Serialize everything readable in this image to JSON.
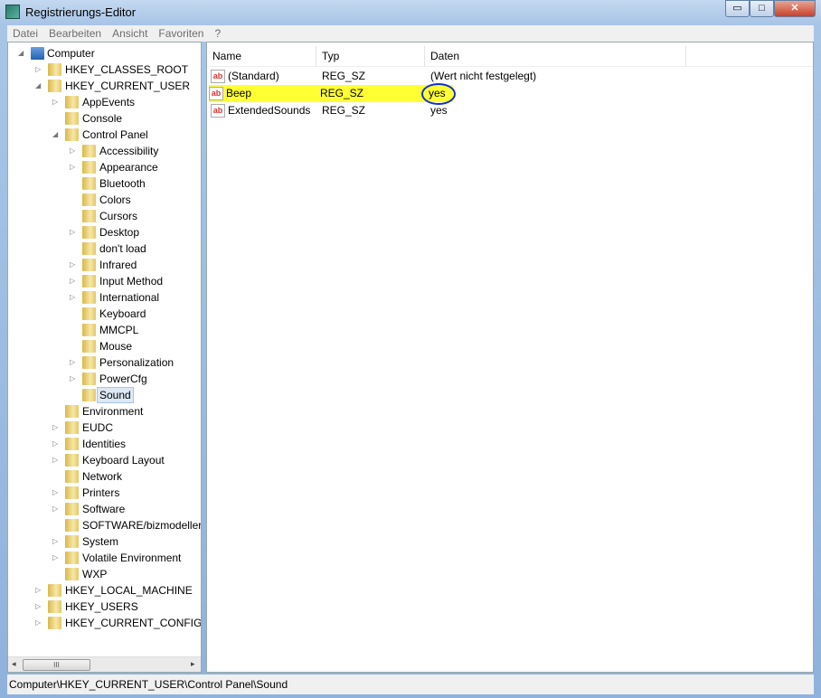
{
  "window": {
    "title": "Registrierungs-Editor",
    "minimize": "▭",
    "maximize": "□",
    "close": "✕"
  },
  "menu": [
    "Datei",
    "Bearbeiten",
    "Ansicht",
    "Favoriten",
    "?"
  ],
  "tree": [
    {
      "label": "Computer",
      "level": 0,
      "expander": "expanded"
    },
    {
      "label": "HKEY_CLASSES_ROOT",
      "level": 1,
      "expander": "collapsed"
    },
    {
      "label": "HKEY_CURRENT_USER",
      "level": 1,
      "expander": "expanded"
    },
    {
      "label": "AppEvents",
      "level": 2,
      "expander": "collapsed"
    },
    {
      "label": "Console",
      "level": 2,
      "expander": "none"
    },
    {
      "label": "Control Panel",
      "level": 2,
      "expander": "expanded"
    },
    {
      "label": "Accessibility",
      "level": 3,
      "expander": "collapsed"
    },
    {
      "label": "Appearance",
      "level": 3,
      "expander": "collapsed"
    },
    {
      "label": "Bluetooth",
      "level": 3,
      "expander": "none"
    },
    {
      "label": "Colors",
      "level": 3,
      "expander": "none"
    },
    {
      "label": "Cursors",
      "level": 3,
      "expander": "none"
    },
    {
      "label": "Desktop",
      "level": 3,
      "expander": "collapsed"
    },
    {
      "label": "don't load",
      "level": 3,
      "expander": "none"
    },
    {
      "label": "Infrared",
      "level": 3,
      "expander": "collapsed"
    },
    {
      "label": "Input Method",
      "level": 3,
      "expander": "collapsed"
    },
    {
      "label": "International",
      "level": 3,
      "expander": "collapsed"
    },
    {
      "label": "Keyboard",
      "level": 3,
      "expander": "none"
    },
    {
      "label": "MMCPL",
      "level": 3,
      "expander": "none"
    },
    {
      "label": "Mouse",
      "level": 3,
      "expander": "none"
    },
    {
      "label": "Personalization",
      "level": 3,
      "expander": "collapsed"
    },
    {
      "label": "PowerCfg",
      "level": 3,
      "expander": "collapsed"
    },
    {
      "label": "Sound",
      "level": 3,
      "expander": "none",
      "selected": true
    },
    {
      "label": "Environment",
      "level": 2,
      "expander": "none"
    },
    {
      "label": "EUDC",
      "level": 2,
      "expander": "collapsed"
    },
    {
      "label": "Identities",
      "level": 2,
      "expander": "collapsed"
    },
    {
      "label": "Keyboard Layout",
      "level": 2,
      "expander": "collapsed"
    },
    {
      "label": "Network",
      "level": 2,
      "expander": "none"
    },
    {
      "label": "Printers",
      "level": 2,
      "expander": "collapsed"
    },
    {
      "label": "Software",
      "level": 2,
      "expander": "collapsed"
    },
    {
      "label": "SOFTWARE/bizmodeller/",
      "level": 2,
      "expander": "none"
    },
    {
      "label": "System",
      "level": 2,
      "expander": "collapsed"
    },
    {
      "label": "Volatile Environment",
      "level": 2,
      "expander": "collapsed"
    },
    {
      "label": "WXP",
      "level": 2,
      "expander": "none"
    },
    {
      "label": "HKEY_LOCAL_MACHINE",
      "level": 1,
      "expander": "collapsed"
    },
    {
      "label": "HKEY_USERS",
      "level": 1,
      "expander": "collapsed"
    },
    {
      "label": "HKEY_CURRENT_CONFIG",
      "level": 1,
      "expander": "collapsed"
    }
  ],
  "scrollbar": {
    "thumb_grip": "III"
  },
  "values": {
    "columns": [
      "Name",
      "Typ",
      "Daten"
    ],
    "rows": [
      {
        "name": "(Standard)",
        "type": "REG_SZ",
        "data": "(Wert nicht festgelegt)",
        "icon": "string-value-icon"
      },
      {
        "name": "Beep",
        "type": "REG_SZ",
        "data": "yes",
        "icon": "string-value-icon",
        "highlighted": true,
        "circled": true
      },
      {
        "name": "ExtendedSounds",
        "type": "REG_SZ",
        "data": "yes",
        "icon": "string-value-icon"
      }
    ],
    "highlight_color": "#ffff33",
    "circle_color": "#1030d0"
  },
  "status": "Computer\\HKEY_CURRENT_USER\\Control Panel\\Sound"
}
